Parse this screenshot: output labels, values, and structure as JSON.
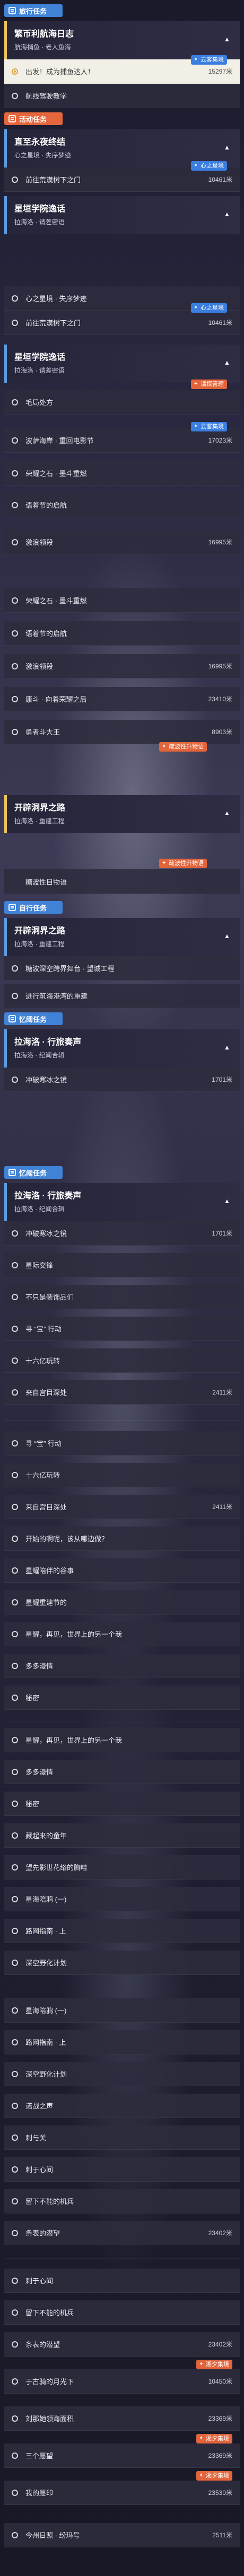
{
  "sections": {
    "daily": "旅行任务",
    "activity": "活动任务",
    "companion": "自行任务",
    "dream": "忆阈任务"
  },
  "badges": {
    "main": "云客集境",
    "dream": "心之星境",
    "tag_orange": "请探管理",
    "tag_next": "阅览星境",
    "tag_story": "疏波性升物语",
    "tag_extra": "湘夕集境"
  },
  "quests": [
    {
      "title": "繁币利航海日志",
      "sub": "航海捕鱼 · 老人鱼海"
    },
    {
      "title": "直至永夜终结",
      "sub": "心之星境 · 失序梦迹"
    },
    {
      "title": "星垣学院逸话",
      "sub": "拉海洛 · 请差密语"
    },
    {
      "title": "星垣学院逸话",
      "sub": "拉海洛 · 请差密语"
    },
    {
      "title": "开辟洞界之路",
      "sub": "拉海洛 · 重建工程"
    },
    {
      "title": "开辟洞界之路",
      "sub": "拉海洛 · 重建工程"
    },
    {
      "title": "拉海洛 · 行旅奏声",
      "sub": "拉海洛 · 纪闻合辑"
    },
    {
      "title": "拉海洛 · 行旅奏声",
      "sub": "拉海洛 · 纪闻合辑"
    }
  ],
  "rows": [
    {
      "label": "出发！成为捕鱼达人！",
      "dist": "15297米"
    },
    {
      "label": "航线驾驶教学",
      "dist": ""
    },
    {
      "label": "前往荒漠树下之门",
      "dist": "10461米"
    },
    {
      "label": "心之星境 · 失序梦迹",
      "dist": ""
    },
    {
      "label": "前往荒漠树下之门",
      "dist": "10461米"
    },
    {
      "label": "毛局处方",
      "dist": ""
    },
    {
      "label": "波萨海岸 · 重回电影节",
      "dist": "17023米"
    },
    {
      "label": "荣耀之石 · 墨斗重燃",
      "dist": ""
    },
    {
      "label": "语着节的启航",
      "dist": ""
    },
    {
      "label": "激浪领段",
      "dist": "16995米"
    },
    {
      "label": "荣耀之石 · 墨斗重燃",
      "dist": ""
    },
    {
      "label": "语着节的启航",
      "dist": ""
    },
    {
      "label": "激浪领段",
      "dist": "16995米"
    },
    {
      "label": "康斗 · 向着荣耀之后",
      "dist": "23410米"
    },
    {
      "label": "勇者斗大王",
      "dist": "8903米"
    },
    {
      "label": "糖波性目物语",
      "dist": ""
    },
    {
      "label": "糖波性目物语",
      "dist": ""
    },
    {
      "label": "糖波深空跨界舞台 · 望城工程",
      "dist": ""
    },
    {
      "label": "进行筑海港湾的重建",
      "dist": ""
    },
    {
      "label": "冲破寒冰之镜",
      "dist": "1701米"
    },
    {
      "label": "冲破寒冰之镜",
      "dist": "1701米"
    },
    {
      "label": "星际交锋",
      "dist": ""
    },
    {
      "label": "不只是装饰品们",
      "dist": ""
    },
    {
      "label": "寻 “宝” 行动",
      "dist": ""
    },
    {
      "label": "十六亿玩转",
      "dist": ""
    },
    {
      "label": "来自宫目深处",
      "dist": "2411米"
    },
    {
      "label": "寻 “宝” 行动",
      "dist": ""
    },
    {
      "label": "十六亿玩转",
      "dist": ""
    },
    {
      "label": "来自宫目深处",
      "dist": "2411米"
    },
    {
      "label": "开始的啊呢，该从哪边做？",
      "dist": ""
    },
    {
      "label": "星耀陪伴的谷事",
      "dist": ""
    },
    {
      "label": "星耀重建节的",
      "dist": ""
    },
    {
      "label": "星耀，再见，世界上的另一个我",
      "dist": ""
    },
    {
      "label": "多多漫情",
      "dist": ""
    },
    {
      "label": "秘密",
      "dist": ""
    },
    {
      "label": "星耀，再见，世界上的另一个我",
      "dist": ""
    },
    {
      "label": "多多漫情",
      "dist": ""
    },
    {
      "label": "秘密",
      "dist": ""
    },
    {
      "label": "藏起来的童年",
      "dist": ""
    },
    {
      "label": "望先影世花络的胸哇",
      "dist": ""
    },
    {
      "label": "星海陪鸦 (一)",
      "dist": ""
    },
    {
      "label": "路网指南 · 上",
      "dist": ""
    },
    {
      "label": "深空野化计划",
      "dist": ""
    },
    {
      "label": "星海陪鸦 (一)",
      "dist": ""
    },
    {
      "label": "路网指南 · 上",
      "dist": ""
    },
    {
      "label": "深空野化计划",
      "dist": ""
    },
    {
      "label": "诺战之声",
      "dist": ""
    },
    {
      "label": "刺与关",
      "dist": ""
    },
    {
      "label": "刺于心间",
      "dist": ""
    },
    {
      "label": "留下不能的机兵",
      "dist": ""
    },
    {
      "label": "条表的潜望",
      "dist": "23402米"
    },
    {
      "label": "刺于心间",
      "dist": ""
    },
    {
      "label": "留下不能的机兵",
      "dist": ""
    },
    {
      "label": "条表的潜望",
      "dist": "23402米"
    },
    {
      "label": "于古骑的月光下",
      "dist": "10450米"
    },
    {
      "label": "刘那她领海面积",
      "dist": "23369米"
    },
    {
      "label": "三个愿望",
      "dist": "23369米"
    },
    {
      "label": "我的愿印",
      "dist": "23530米"
    },
    {
      "label": "今州日照 · 纷玛号",
      "dist": "2511米"
    }
  ]
}
